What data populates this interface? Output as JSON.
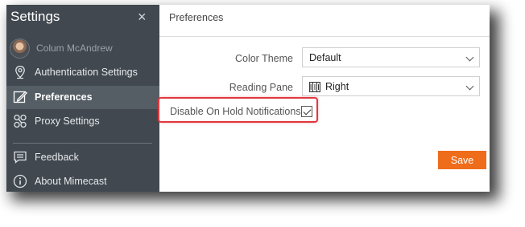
{
  "sidebar": {
    "title": "Settings",
    "close_glyph": "×",
    "user_name": "Colum McAndrew",
    "items": [
      {
        "label": "Authentication Settings",
        "icon": "location-pin-icon"
      },
      {
        "label": "Preferences",
        "icon": "edit-pencil-icon",
        "active": true
      },
      {
        "label": "Proxy Settings",
        "icon": "proxy-nodes-icon"
      },
      {
        "label": "Feedback",
        "icon": "feedback-icon"
      },
      {
        "label": "About Mimecast",
        "icon": "info-icon"
      }
    ]
  },
  "main": {
    "title": "Preferences",
    "color_theme": {
      "label": "Color Theme",
      "value": "Default"
    },
    "reading_pane": {
      "label": "Reading Pane",
      "value": "Right",
      "icon": "columns-icon"
    },
    "disable_on_hold": {
      "label": "Disable On Hold Notifications",
      "checked": true
    },
    "save_label": "Save"
  },
  "colors": {
    "sidebar_bg": "#41484f",
    "active_item_bg": "#555d65",
    "save_button": "#ef6c1a",
    "highlight_border": "#e0383e"
  }
}
